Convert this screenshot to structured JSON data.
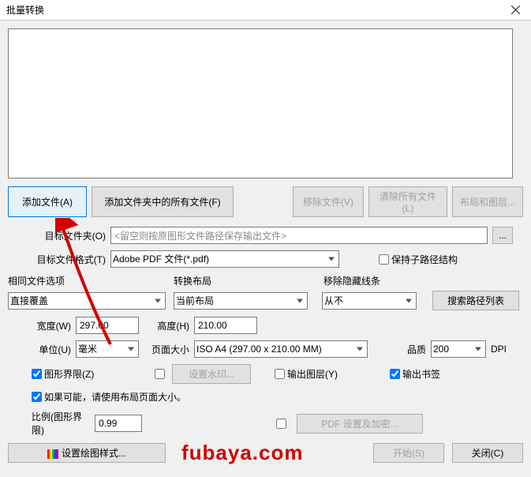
{
  "title": "批量转换",
  "buttons": {
    "add_file": "添加文件(A)",
    "add_folder": "添加文件夹中的所有文件(F)",
    "remove_file": "移除文件(V)",
    "clear_all": "清除所有文件(L)",
    "layout_layers": "布局和图层...",
    "dots": "...",
    "search_path_list": "搜索路径列表",
    "set_watermark": "设置水印...",
    "pdf_settings": "PDF 设置及加密...",
    "set_plot_style": "设置绘图样式...",
    "start": "开始(S)",
    "close": "关闭(C)"
  },
  "labels": {
    "target_folder": "目标文件夹(O)",
    "target_format": "目标文件格式(T)",
    "keep_subpath": "保持子路径结构",
    "same_file_option": "相同文件选项",
    "convert_layout": "转换布局",
    "remove_hidden": "移除隐藏线条",
    "width": "宽度(W)",
    "height": "高度(H)",
    "unit": "单位(U)",
    "page_size": "页面大小",
    "quality": "品质",
    "dpi": "DPI",
    "graphic_bounds": "图形界限(Z)",
    "output_layer": "输出图层(Y)",
    "output_bookmark": "输出书签",
    "use_layout_pagesize": "如果可能，请使用布局页面大小。",
    "scale": "比例(图形界限)"
  },
  "placeholders": {
    "target_folder_ph": "<留空则按原图形文件路径保存输出文件>"
  },
  "selects": {
    "format": "Adobe PDF 文件(*.pdf)",
    "same_file": "直接覆盖",
    "layout": "当前布局",
    "hidden": "从不",
    "unit": "毫米",
    "pagesize": "ISO A4 (297.00 x 210.00 MM)",
    "dpi": "200"
  },
  "values": {
    "width": "297.00",
    "height": "210.00",
    "scale": "0.99"
  },
  "watermark": "fubaya.com"
}
